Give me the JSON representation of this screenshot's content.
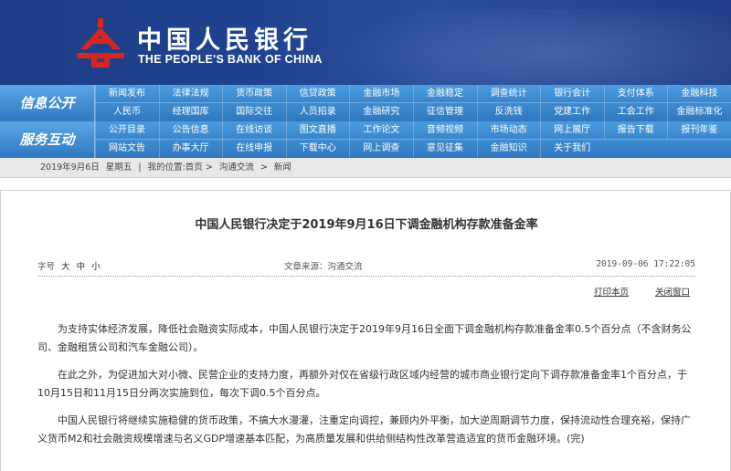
{
  "header": {
    "logo_cn": "中国人民银行",
    "logo_en": "THE PEOPLE'S BANK OF CHINA"
  },
  "nav": {
    "sections": [
      "信息公开",
      "服务互动"
    ],
    "rows": [
      [
        "新闻发布",
        "法律法规",
        "货币政策",
        "信贷政策",
        "金融市场",
        "金融稳定",
        "调查统计",
        "银行会计",
        "支付体系",
        "金融科技"
      ],
      [
        "人民币",
        "经理国库",
        "国际交往",
        "人员招录",
        "金融研究",
        "征信管理",
        "反洗钱",
        "党建工作",
        "工会工作",
        "金融标准化"
      ],
      [
        "公开目录",
        "公告信息",
        "在线访谈",
        "图文直播",
        "工作论文",
        "音频视频",
        "市场动态",
        "网上展厅",
        "报告下载",
        "报刊年鉴"
      ],
      [
        "网站文告",
        "办事大厅",
        "在线申报",
        "下载中心",
        "网上调查",
        "意见征集",
        "金融知识",
        "关于我们"
      ]
    ]
  },
  "crumb": {
    "date": "2019年9月6日",
    "weekday": "星期五",
    "sep": "|",
    "location_label": "我的位置:",
    "path": [
      "首页",
      "沟通交流",
      "新闻"
    ],
    "arrow": ">"
  },
  "article": {
    "title": "中国人民银行决定于2019年9月16日下调金融机构存款准备金率",
    "font_size_label": "字号",
    "font_sizes": [
      "大",
      "中",
      "小"
    ],
    "source": "文章来源：沟通交流",
    "time": "2019-09-06 17:22:05",
    "print_label": "打印本页",
    "close_label": "关闭窗口",
    "paragraphs": [
      "为支持实体经济发展，降低社会融资实际成本，中国人民银行决定于2019年9月16日全面下调金融机构存款准备金率0.5个百分点（不含财务公司、金融租赁公司和汽车金融公司）。",
      "在此之外，为促进加大对小微、民营企业的支持力度，再额外对仅在省级行政区域内经营的城市商业银行定向下调存款准备金率1个百分点，于10月15日和11月15日分两次实施到位，每次下调0.5个百分点。",
      "中国人民银行将继续实施稳健的货币政策，不搞大水漫灌，注重定向调控，兼顾内外平衡，加大逆周期调节力度，保持流动性合理充裕，保持广义货币M2和社会融资规模增速与名义GDP增速基本匹配，为高质量发展和供给侧结构性改革营造适宜的货币金融环境。(完)"
    ]
  },
  "colors": {
    "header_bg": "#1f4390",
    "nav_bg": "#3f8cd0",
    "logo_red": "#d8261c"
  }
}
